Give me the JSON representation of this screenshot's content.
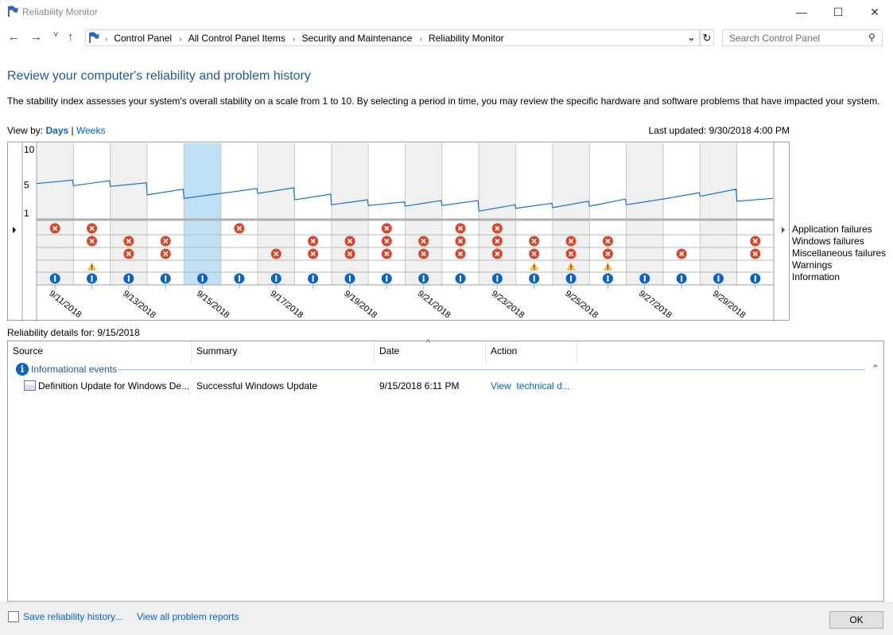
{
  "window": {
    "title": "Reliability Monitor",
    "minimize": "—",
    "maximize": "☐",
    "close": "✕"
  },
  "nav": {
    "back": "←",
    "forward": "→",
    "recent": "˅",
    "up": "↑",
    "breadcrumbs": [
      "Control Panel",
      "All Control Panel Items",
      "Security and Maintenance",
      "Reliability Monitor"
    ],
    "dropdown": "⌄",
    "refresh": "↻",
    "search_placeholder": "Search Control Panel",
    "search_icon": "⚲"
  },
  "page": {
    "heading": "Review your computer's reliability and problem history",
    "description": "The stability index assesses your system's overall stability on a scale from 1 to 10. By selecting a period in time, you may review the specific hardware and software problems that have impacted your system.",
    "view_by_label": "View by:",
    "view_days": "Days",
    "view_sep": "|",
    "view_weeks": "Weeks",
    "last_updated": "Last updated: 9/30/2018 4:00 PM"
  },
  "chart_data": {
    "type": "line",
    "ylim": [
      1,
      10
    ],
    "yticks": [
      "10",
      "5",
      "1"
    ],
    "dates": [
      "9/11/2018",
      "9/12/2018",
      "9/13/2018",
      "9/14/2018",
      "9/15/2018",
      "9/16/2018",
      "9/17/2018",
      "9/18/2018",
      "9/19/2018",
      "9/20/2018",
      "9/21/2018",
      "9/22/2018",
      "9/23/2018",
      "9/24/2018",
      "9/25/2018",
      "9/26/2018",
      "9/27/2018",
      "9/28/2018",
      "9/29/2018",
      "9/30/2018"
    ],
    "date_labels": [
      "9/11/2018",
      "9/13/2018",
      "9/15/2018",
      "9/17/2018",
      "9/19/2018",
      "9/21/2018",
      "9/23/2018",
      "9/25/2018",
      "9/27/2018",
      "9/29/2018"
    ],
    "selected_date": "9/15/2018",
    "stability_start": [
      5.2,
      4.9,
      4.8,
      3.6,
      3.1,
      3.8,
      3.8,
      2.9,
      2.2,
      2.1,
      2.0,
      2.1,
      1.3,
      1.7,
      1.8,
      2.0,
      2.2,
      3.0,
      3.4,
      2.7
    ],
    "stability_end": [
      5.7,
      5.6,
      5.3,
      4.4,
      3.8,
      4.5,
      4.6,
      3.7,
      2.9,
      2.6,
      2.8,
      2.8,
      2.2,
      2.4,
      2.7,
      3.0,
      3.0,
      3.9,
      4.4,
      3.1
    ],
    "event_rows": [
      "Application failures",
      "Windows failures",
      "Miscellaneous failures",
      "Warnings",
      "Information"
    ],
    "events": {
      "Application failures": [
        1,
        1,
        0,
        0,
        0,
        1,
        0,
        0,
        0,
        1,
        0,
        1,
        1,
        0,
        0,
        0,
        0,
        0,
        0,
        0
      ],
      "Windows failures": [
        0,
        1,
        1,
        1,
        0,
        0,
        0,
        1,
        1,
        1,
        1,
        1,
        1,
        1,
        1,
        1,
        0,
        0,
        0,
        1
      ],
      "Miscellaneous failures": [
        0,
        0,
        1,
        1,
        0,
        0,
        1,
        1,
        1,
        1,
        1,
        1,
        1,
        1,
        1,
        1,
        0,
        1,
        0,
        1
      ],
      "Warnings": [
        0,
        1,
        0,
        0,
        0,
        0,
        0,
        0,
        0,
        0,
        0,
        0,
        0,
        1,
        1,
        1,
        0,
        0,
        0,
        0
      ],
      "Information": [
        1,
        1,
        1,
        1,
        1,
        1,
        1,
        1,
        1,
        1,
        1,
        1,
        1,
        1,
        1,
        1,
        1,
        1,
        1,
        1
      ]
    },
    "colors": {
      "line": "#1a73d0",
      "error": "#d9472b",
      "warning": "#f7c15a",
      "info": "#0b63c4",
      "selected": "#bfe0f5",
      "shade": "#f0f0f0"
    }
  },
  "details": {
    "label": "Reliability details for: 9/15/2018",
    "columns": [
      "Source",
      "Summary",
      "Date",
      "Action"
    ],
    "sort_indicator": "^",
    "group": "Informational events",
    "collapse": "⌃",
    "rows": [
      {
        "source": "Definition Update for Windows De...",
        "summary": "Successful Windows Update",
        "date": "9/15/2018 6:11 PM",
        "action": "View  technical d..."
      }
    ]
  },
  "footer": {
    "save": "Save reliability history...",
    "view_all": "View all problem reports",
    "ok": "OK"
  }
}
